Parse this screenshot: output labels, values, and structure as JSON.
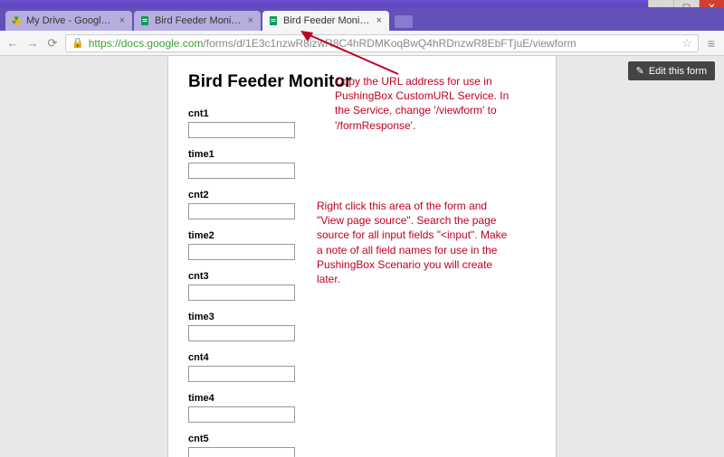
{
  "window": {
    "min": "—",
    "max": "▢",
    "close": "✕"
  },
  "tabs": [
    {
      "label": "My Drive - Google Drive"
    },
    {
      "label": "Bird Feeder Monitor - Goo"
    },
    {
      "label": "Bird Feeder Monitor"
    }
  ],
  "nav": {
    "back": "←",
    "fwd": "→",
    "reload": "⟳",
    "star": "☆",
    "menu": "≡"
  },
  "url": {
    "proto": "https://",
    "host": "docs.google.com",
    "path": "/forms/d/1E3c1nzwR8izwR8C4hRDMKoqBwQ4hRDnzwR8EbFTjuE/viewform"
  },
  "editFormButton": "Edit this form",
  "form": {
    "title": "Bird Feeder Monitor",
    "fields": [
      {
        "label": "cnt1"
      },
      {
        "label": "time1"
      },
      {
        "label": "cnt2"
      },
      {
        "label": "time2"
      },
      {
        "label": "cnt3"
      },
      {
        "label": "time3"
      },
      {
        "label": "cnt4"
      },
      {
        "label": "time4"
      },
      {
        "label": "cnt5"
      }
    ]
  },
  "annotations": {
    "top": "Copy the URL address for use in PushingBox CustomURL Service.  In the Service, change '/viewform' to '/formResponse'.",
    "mid": "Right click this area of the form and \"View page source\".  Search the page source for all input fields \"<input\".  Make a note of all field names for use in the PushingBox Scenario you will create later."
  },
  "colors": {
    "annotation": "#c00020",
    "chrome": "#6351b8"
  }
}
